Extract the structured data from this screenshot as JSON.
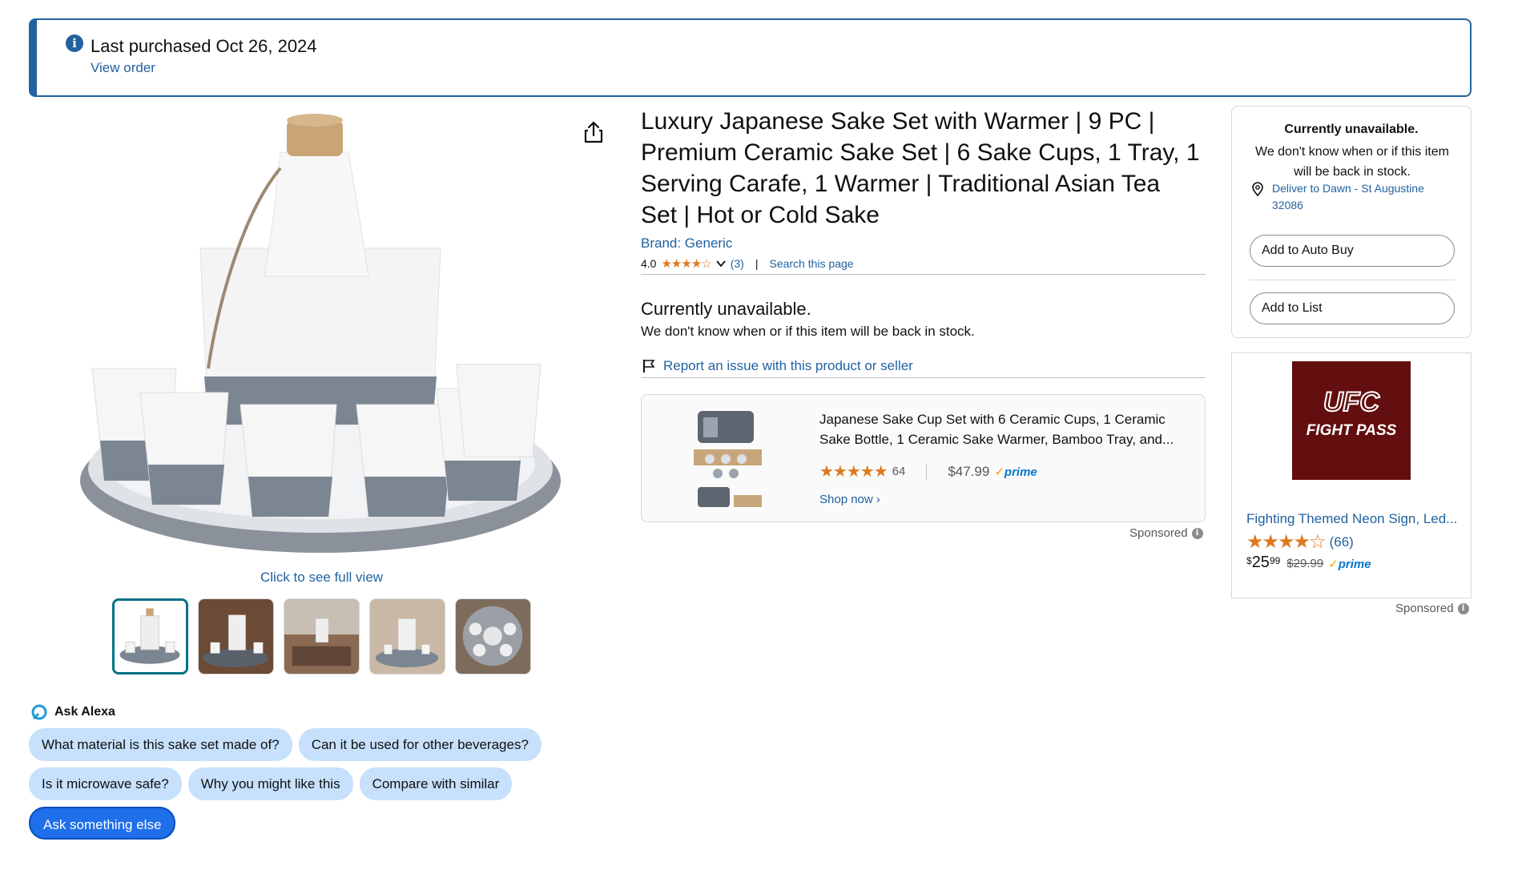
{
  "banner": {
    "title": "Last purchased Oct 26, 2024",
    "link": "View order",
    "icon": "info-icon"
  },
  "gallery": {
    "full_view": "Click to see full view",
    "thumbnails": [
      "thumb-1",
      "thumb-2",
      "thumb-3",
      "thumb-4",
      "thumb-5"
    ],
    "selected_index": 0
  },
  "alexa": {
    "label": "Ask Alexa",
    "chips": [
      "What material is this sake set made of?",
      "Can it be used for other beverages?",
      "Is it microwave safe?",
      "Why you might like this",
      "Compare with similar"
    ],
    "ask_else": "Ask something else"
  },
  "product": {
    "title": "Luxury Japanese Sake Set with Warmer | 9 PC | Premium Ceramic Sake Set | 6 Sake Cups, 1 Tray, 1 Serving Carafe, 1 Warmer | Traditional Asian Tea Set | Hot or Cold Sake",
    "brand": "Brand: Generic",
    "rating_value": "4.0",
    "rating_stars": 4,
    "rating_count": "(3)",
    "search_page": "Search this page",
    "separator": "|"
  },
  "availability": {
    "title": "Currently unavailable.",
    "text": "We don't know when or if this item will be back in stock.",
    "report": "Report an issue with this product or seller"
  },
  "sponsored_product": {
    "title": "Japanese Sake Cup Set with 6 Ceramic Cups, 1 Ceramic Sake Bottle, 1 Ceramic Sake Warmer, Bamboo Tray, and...",
    "stars": "★★★★★",
    "rating_count": "64",
    "price": "$47.99",
    "prime": "prime",
    "shop_now": "Shop now ›",
    "sponsored": "Sponsored"
  },
  "buybox": {
    "title": "Currently unavailable.",
    "text": "We don't know when or if this item will be back in stock.",
    "location": "Deliver to Dawn - St Augustine 32086",
    "auto_buy": "Add to Auto Buy",
    "add_to_list": "Add to List"
  },
  "ad": {
    "logo_line1": "UFC",
    "logo_line2": "FIGHT PASS",
    "title": "Fighting Themed Neon Sign, Led...",
    "stars": "★★★★☆",
    "rating_count": "(66)",
    "price_dollar": "$",
    "price_whole": "25",
    "price_cents": "99",
    "list_price": "$29.99",
    "prime": "prime",
    "sponsored": "Sponsored"
  },
  "colors": {
    "link": "#2162a1",
    "star": "#de7921",
    "chip": "#c7e0fb",
    "chip_primary": "#1f6fea",
    "prime": "#0077cc"
  }
}
